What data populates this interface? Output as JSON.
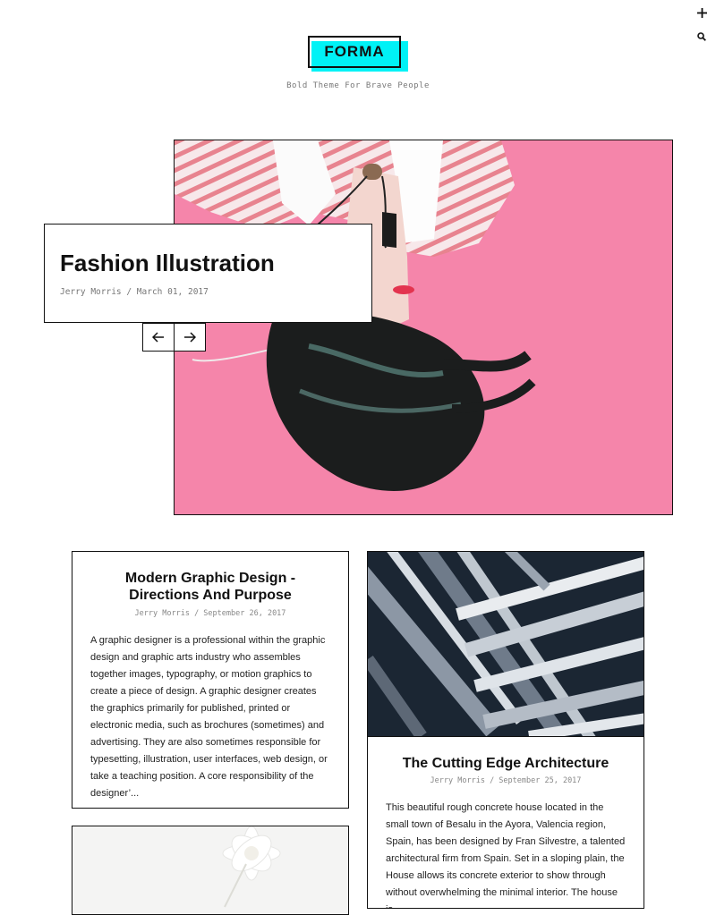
{
  "header": {
    "logo": "FORMA",
    "tagline": "Bold Theme For Brave People",
    "colors": {
      "accent": "#00f2f6",
      "ink": "#111111"
    }
  },
  "toolbar": {
    "add_icon": "plus-icon",
    "search_icon": "search-icon"
  },
  "hero": {
    "title": "Fashion Illustration",
    "meta": "Jerry Morris / March 01, 2017",
    "prev_icon": "arrow-left-icon",
    "next_icon": "arrow-right-icon",
    "background_color": "#f585aa"
  },
  "posts": [
    {
      "title": "Modern Graphic Design - Directions And Purpose",
      "meta": "Jerry Morris / September 26, 2017",
      "excerpt": "A graphic designer is a professional within the graphic design and graphic arts industry who assembles together images, typography, or motion graphics to create a piece of design. A graphic designer creates the graphics primarily for published, printed or electronic media, such as brochures (sometimes) and advertising. They are also sometimes responsible for typesetting, illustration, user interfaces, web design, or take a teaching position. A core responsibility of the designer’..."
    },
    {
      "title": "The Cutting Edge Architecture",
      "meta": "Jerry Morris / September 25, 2017",
      "excerpt": "This beautiful rough concrete house located in the small town of Besalu in the Ayora, Valencia region, Spain, has been designed by Fran Silvestre, a talented architectural firm from Spain. Set in a sloping plain, the House allows its concrete exterior to show through without overwhelming the minimal interior. The house is"
    }
  ]
}
